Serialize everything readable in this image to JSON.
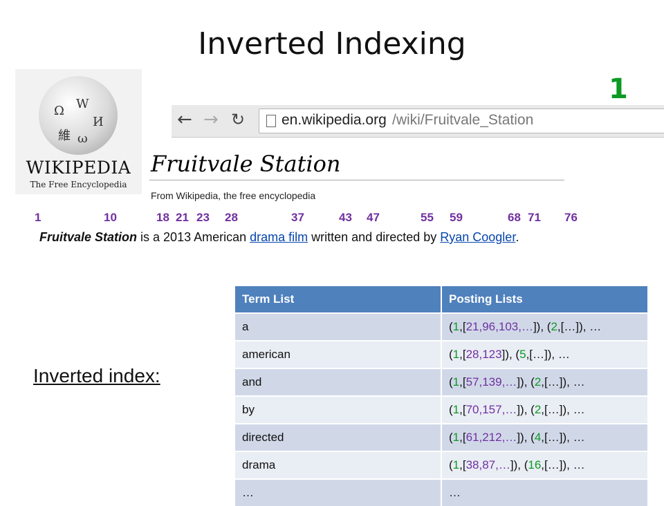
{
  "title": "Inverted Indexing",
  "doc_id": "1",
  "logo": {
    "wordmark": "WIKIPEDIA",
    "tagline": "The Free Encyclopedia",
    "glyphs": [
      "Ω",
      "W",
      "И",
      "維",
      "ω"
    ]
  },
  "browser": {
    "back_icon": "back-arrow-icon",
    "forward_icon": "forward-arrow-icon",
    "reload_icon": "reload-icon",
    "url_domain": "en.wikipedia.org",
    "url_path": "/wiki/Fruitvale_Station"
  },
  "article": {
    "title": "Fruitvale Station",
    "from": "From Wikipedia, the free encyclopedia"
  },
  "positions": [
    "1",
    "10",
    "18",
    "21",
    "23",
    "28",
    "37",
    "43",
    "47",
    "55",
    "59",
    "68",
    "71",
    "76"
  ],
  "sentence": {
    "bold_italic": "Fruitvale Station",
    "text1": " is a 2013 American ",
    "link1": "drama film",
    "text2": " written and directed by ",
    "link2": "Ryan Coogler",
    "text3": "."
  },
  "inverted_label": "Inverted index:",
  "table": {
    "headers": [
      "Term List",
      "Posting Lists"
    ],
    "rows": [
      {
        "term": "a",
        "postings": [
          {
            "doc": "1",
            "pos": "21,96,103,…"
          },
          {
            "doc": "2",
            "pos": "…"
          }
        ],
        "tail": ", …"
      },
      {
        "term": "american",
        "postings": [
          {
            "doc": "1",
            "pos": "28,123"
          },
          {
            "doc": "5",
            "pos": "…"
          }
        ],
        "tail": ", …"
      },
      {
        "term": "and",
        "postings": [
          {
            "doc": "1",
            "pos": "57,139,…"
          },
          {
            "doc": "2",
            "pos": "…"
          }
        ],
        "tail": ", …"
      },
      {
        "term": "by",
        "postings": [
          {
            "doc": "1",
            "pos": "70,157,…"
          },
          {
            "doc": "2",
            "pos": "…"
          }
        ],
        "tail": ", …"
      },
      {
        "term": "directed",
        "postings": [
          {
            "doc": "1",
            "pos": "61,212,…"
          },
          {
            "doc": "4",
            "pos": "…"
          }
        ],
        "tail": ", …"
      },
      {
        "term": "drama",
        "postings": [
          {
            "doc": "1",
            "pos": "38,87,…"
          },
          {
            "doc": "16",
            "pos": "…"
          }
        ],
        "tail": ", …"
      },
      {
        "term": "…",
        "postings": [],
        "tail": "…"
      }
    ]
  },
  "colors": {
    "doc_id": "#0b9a23",
    "position": "#7030a0",
    "header": "#4f81bd",
    "row_odd": "#d0d8e8",
    "row_even": "#e9edf4",
    "link": "#0645ad"
  }
}
